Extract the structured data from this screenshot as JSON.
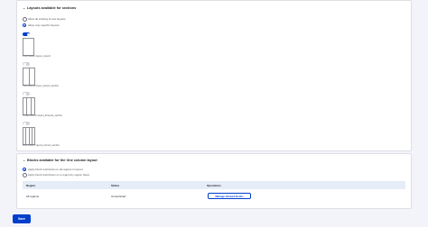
{
  "sections": {
    "title": "Layouts available for sections",
    "radios": [
      {
        "label": "Allow all existing & new layouts",
        "checked": false
      },
      {
        "label": "Allow only specific layouts",
        "checked": true
      }
    ],
    "layouts": [
      {
        "caption": "One column layout_onecol",
        "enabled": true,
        "columns": 1
      },
      {
        "caption": "Two column layout_twocol_section",
        "enabled": false,
        "columns": 2
      },
      {
        "caption": "Three column layout_threecol_section",
        "enabled": false,
        "columns": 3
      },
      {
        "caption": "Four column layout_fourcol_section",
        "enabled": false,
        "columns": 4
      }
    ]
  },
  "blocks": {
    "title": "Blocks available for the One column layout",
    "radios": [
      {
        "label": "Apply block restrictions to all regions in layout",
        "checked": true
      },
      {
        "label": "Apply block restrictions on a region-by-region basis",
        "checked": false
      }
    ],
    "table": {
      "headers": [
        "Region",
        "Status",
        "Operations"
      ],
      "row": {
        "region": "All regions",
        "status": "Unrestricted",
        "operation": "Manage allowed blocks"
      }
    }
  },
  "save_label": "Save",
  "colors": {
    "accent": "#003ecc",
    "background": "#f3f4f9",
    "table_header": "#e6ecf8"
  }
}
